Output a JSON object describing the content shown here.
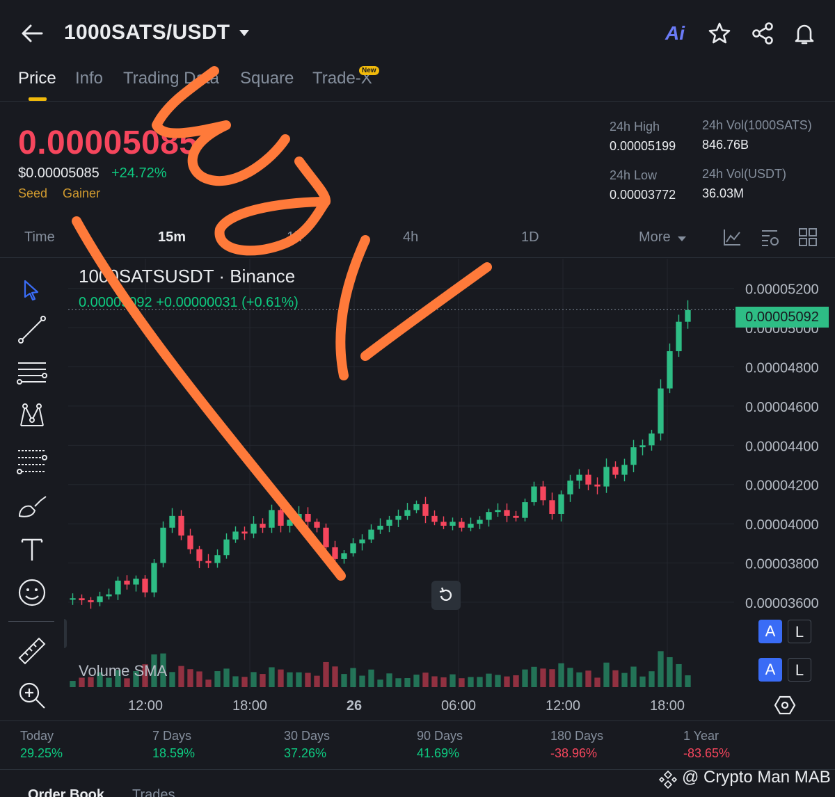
{
  "header": {
    "pair": "1000SATS/USDT",
    "ai_label": "Ai"
  },
  "tabs": [
    {
      "label": "Price"
    },
    {
      "label": "Info"
    },
    {
      "label": "Trading Data"
    },
    {
      "label": "Square"
    },
    {
      "label": "Trade-X"
    }
  ],
  "new_badge": "New",
  "price": {
    "last": "0.00005085",
    "usd": "$0.00005085",
    "change_pct": "+24.72%",
    "tags": [
      "Seed",
      "Gainer"
    ]
  },
  "stats": {
    "high_label": "24h High",
    "high_value": "0.00005199",
    "low_label": "24h Low",
    "low_value": "0.00003772",
    "vol_base_label": "24h Vol(1000SATS)",
    "vol_base_value": "846.76B",
    "vol_quote_label": "24h Vol(USDT)",
    "vol_quote_value": "36.03M"
  },
  "timeframes": {
    "items": [
      "Time",
      "15m",
      "1h",
      "4h",
      "1D"
    ],
    "selected": "15m",
    "more": "More"
  },
  "chart_legend": {
    "title": "1000SATSUSDT · Binance",
    "values": "0.00005092 +0.00000031 (+0.61%)"
  },
  "volume_label": "Volume SMA",
  "current_price_tag": "0.00005092",
  "al_buttons": {
    "a": "A",
    "l": "L"
  },
  "colors": {
    "up": "#2ebd85",
    "down": "#f6465d",
    "accent": "#f0b90b",
    "background": "#181a20",
    "scribble": "#ff7a3a"
  },
  "chart_data": {
    "type": "candlestick",
    "y_ticks": [
      "0.00005200",
      "0.00005000",
      "0.00004800",
      "0.00004600",
      "0.00004400",
      "0.00004200",
      "0.00004000",
      "0.00003800",
      "0.00003600"
    ],
    "x_ticks": [
      "12:00",
      "18:00",
      "26",
      "06:00",
      "12:00",
      "18:00"
    ],
    "ylim": [
      3.55e-05,
      5.27e-05
    ],
    "last_price": 5.092e-05,
    "series_close": [
      3.62e-05,
      3.61e-05,
      3.6e-05,
      3.63e-05,
      3.64e-05,
      3.71e-05,
      3.69e-05,
      3.72e-05,
      3.65e-05,
      3.8e-05,
      3.98e-05,
      4.04e-05,
      3.94e-05,
      3.87e-05,
      3.81e-05,
      3.8e-05,
      3.84e-05,
      3.92e-05,
      3.96e-05,
      3.95e-05,
      4e-05,
      3.98e-05,
      4.07e-05,
      3.99e-05,
      4.02e-05,
      4.05e-05,
      4.01e-05,
      3.98e-05,
      3.88e-05,
      3.82e-05,
      3.85e-05,
      3.9e-05,
      3.92e-05,
      3.97e-05,
      3.99e-05,
      4.02e-05,
      4.04e-05,
      4.07e-05,
      4.1e-05,
      4.04e-05,
      4.01e-05,
      3.99e-05,
      4.01e-05,
      3.98e-05,
      4e-05,
      4.02e-05,
      4.06e-05,
      4.07e-05,
      4.04e-05,
      4.03e-05,
      4.11e-05,
      4.19e-05,
      4.12e-05,
      4.05e-05,
      4.15e-05,
      4.22e-05,
      4.25e-05,
      4.2e-05,
      4.19e-05,
      4.29e-05,
      4.25e-05,
      4.3e-05,
      4.39e-05,
      4.4e-05,
      4.46e-05,
      4.69e-05,
      4.88e-05,
      5.03e-05,
      5.09e-05
    ]
  },
  "performance": [
    {
      "label": "Today",
      "value": "29.25%"
    },
    {
      "label": "7 Days",
      "value": "18.59%"
    },
    {
      "label": "30 Days",
      "value": "37.26%"
    },
    {
      "label": "90 Days",
      "value": "41.69%"
    },
    {
      "label": "180 Days",
      "value": "-38.96%"
    },
    {
      "label": "1 Year",
      "value": "-83.65%"
    }
  ],
  "bottom_tabs": [
    "Order Book",
    "Trades"
  ],
  "watermark": "@ Crypto Man MAB"
}
